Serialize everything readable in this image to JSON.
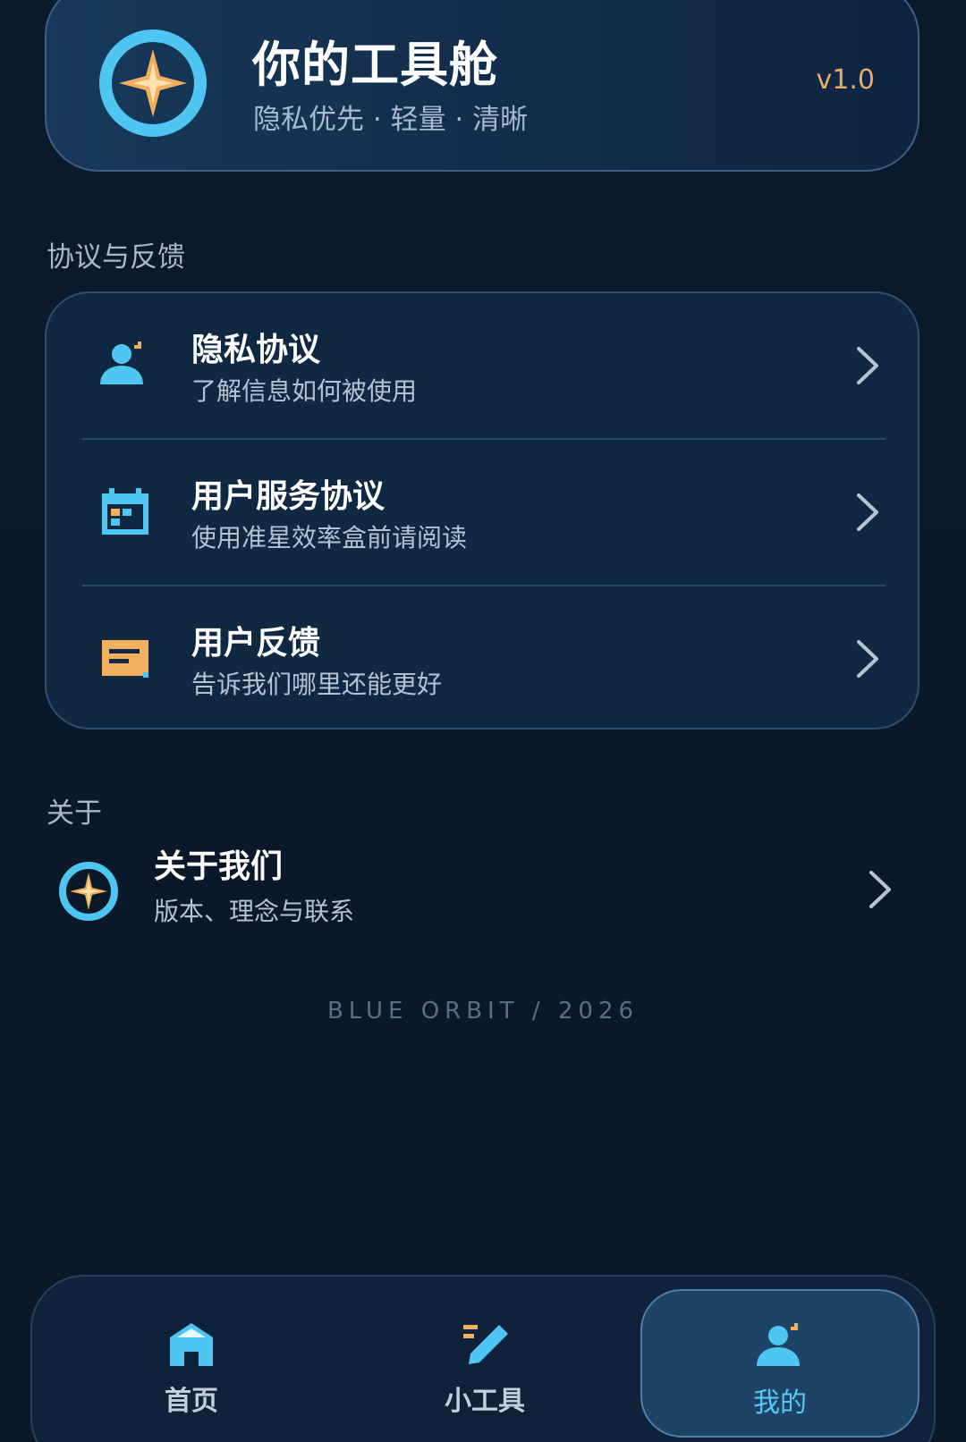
{
  "header": {
    "title": "你的工具舱",
    "subtitle": "隐私优先 · 轻量 · 清晰",
    "version": "v1.0",
    "logo_icon": "compass-star-icon"
  },
  "agreements": {
    "section_label": "协议与反馈",
    "items": [
      {
        "title": "隐私协议",
        "desc": "了解信息如何被使用",
        "icon": "person-icon"
      },
      {
        "title": "用户服务协议",
        "desc": "使用准星效率盒前请阅读",
        "icon": "calendar-icon"
      },
      {
        "title": "用户反馈",
        "desc": "告诉我们哪里还能更好",
        "icon": "message-icon"
      }
    ]
  },
  "about": {
    "section_label": "关于",
    "title": "关于我们",
    "desc": "版本、理念与联系",
    "icon": "compass-star-icon"
  },
  "footer": {
    "mark": "BLUE ORBIT / 2026"
  },
  "nav": {
    "items": [
      {
        "label": "首页",
        "icon": "home-icon",
        "active": false
      },
      {
        "label": "小工具",
        "icon": "pencil-tools-icon",
        "active": false
      },
      {
        "label": "我的",
        "icon": "person-icon",
        "active": true
      }
    ]
  },
  "colors": {
    "background": "#0b1a2a",
    "card": "#112843",
    "accent_blue": "#4fc6f2",
    "accent_orange": "#f2b05e",
    "version": "#e2ad64",
    "active_tab": "#59c9f4"
  }
}
